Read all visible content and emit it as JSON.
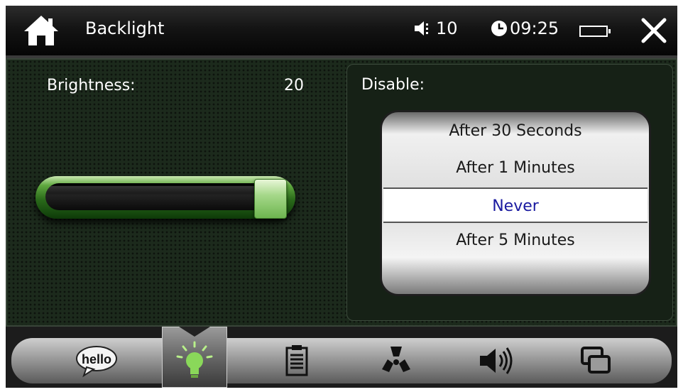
{
  "title_bar": {
    "title": "Backlight",
    "volume": "10",
    "time": "09:25"
  },
  "brightness": {
    "label": "Brightness:",
    "value": "20",
    "level_fraction": 1.0
  },
  "disable": {
    "label": "Disable:",
    "options": [
      "After 30 Seconds",
      "After 1 Minutes",
      "Never",
      "After 5 Minutes"
    ],
    "selected": "Never"
  },
  "toolbar": {
    "hello_label": "hello",
    "active_tab": "backlight"
  },
  "colors": {
    "accent_green": "#6db54f",
    "selected_text": "#1a1aa0",
    "background": "#1c2a1c"
  },
  "icons": {
    "home": "home-icon",
    "speaker": "speaker-icon",
    "clock": "clock-icon",
    "battery": "battery-icon",
    "close": "close-icon",
    "hello": "hello-bubble-icon",
    "bulb": "bulb-icon",
    "clipboard": "clipboard-icon",
    "radiation": "radiation-icon",
    "volume": "volume-icon",
    "windows": "windows-icon"
  }
}
